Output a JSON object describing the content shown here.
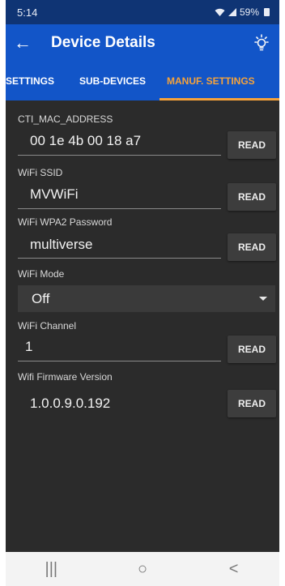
{
  "status_bar": {
    "time": "5:14",
    "battery": "59%"
  },
  "app_bar": {
    "title": "Device Details"
  },
  "tabs": [
    {
      "label": "SETTINGS",
      "active": false
    },
    {
      "label": "SUB-DEVICES",
      "active": false
    },
    {
      "label": "MANUF. SETTINGS",
      "active": true
    }
  ],
  "fields": {
    "mac": {
      "label": "CTI_MAC_ADDRESS",
      "value": "00 1e 4b 00 18 a7",
      "button": "READ"
    },
    "ssid": {
      "label": "WiFi SSID",
      "value": "MVWiFi",
      "button": "READ"
    },
    "password": {
      "label": "WiFi WPA2 Password",
      "value": "multiverse",
      "button": "READ"
    },
    "mode": {
      "label": "WiFi Mode",
      "value": "Off"
    },
    "channel": {
      "label": "WiFi Channel",
      "value": "1",
      "button": "READ"
    },
    "firmware": {
      "label": "Wifi Firmware Version",
      "value": "1.0.0.9.0.192",
      "button": "READ"
    }
  },
  "nav_bar": {
    "recents": "|||",
    "home": "○",
    "back": "<"
  },
  "colors": {
    "app_bar": "#1255c8",
    "status_bar": "#0f3474",
    "accent": "#f6a33a",
    "background": "#2b2b2b"
  },
  "icons": [
    "back-arrow-icon",
    "lightbulb-icon",
    "wifi-icon",
    "signal-icon",
    "battery-icon",
    "dropdown-caret-icon"
  ]
}
